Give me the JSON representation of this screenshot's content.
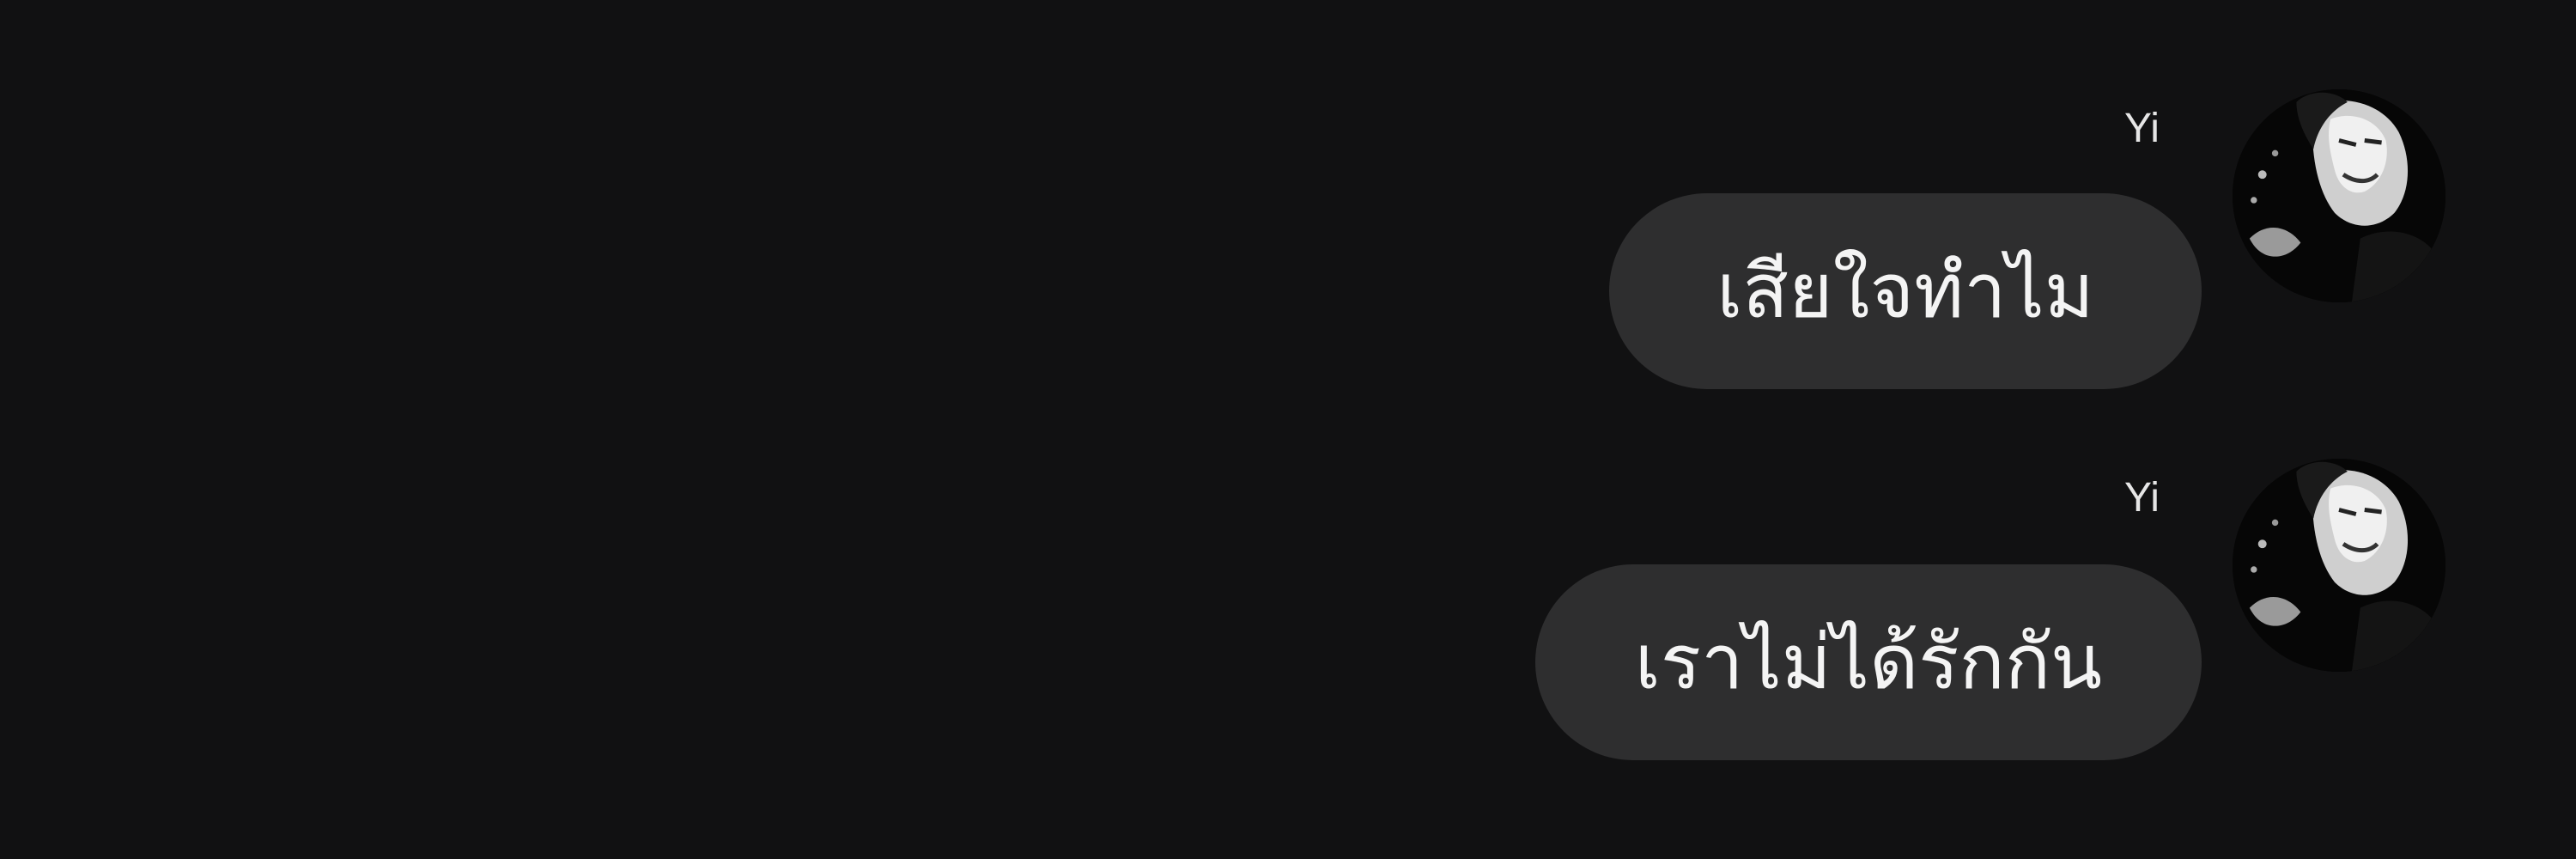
{
  "colors": {
    "background": "#111112",
    "bubble": "#2e2e2f",
    "text": "#f4f4f4"
  },
  "messages": [
    {
      "sender": "Yi",
      "text": "เสียใจทำไม",
      "avatar": "avatar-photo"
    },
    {
      "sender": "Yi",
      "text": "เราไม่ได้รักกัน",
      "avatar": "avatar-photo"
    }
  ]
}
